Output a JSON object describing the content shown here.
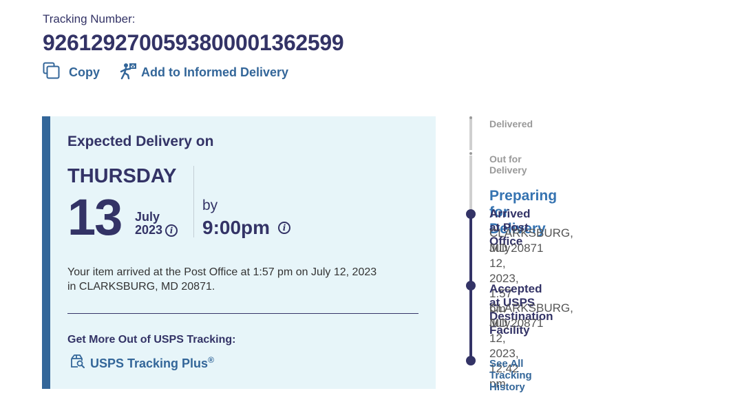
{
  "tracking": {
    "label": "Tracking Number:",
    "number": "9261292700593800001362599",
    "copy_label": "Copy",
    "informed_delivery_label": "Add to Informed Delivery"
  },
  "expected_delivery": {
    "title": "Expected Delivery on",
    "day_of_week": "THURSDAY",
    "date": "13",
    "month": "July",
    "year": "2023",
    "by_label": "by",
    "time": "9:00pm",
    "message_line1": "Your item arrived at the Post Office at 1:57 pm on July 12, 2023",
    "message_line2": "in CLARKSBURG, MD 20871.",
    "get_more_label": "Get More Out of USPS Tracking:",
    "tracking_plus_label": "USPS Tracking Plus",
    "tracking_plus_mark": "®"
  },
  "progress": {
    "steps": [
      "Delivered",
      "Out for Delivery"
    ],
    "current_status": "Preparing for Delivery",
    "events": [
      {
        "event": "Arrived at Post Office",
        "location": "CLARKSBURG, MD 20871",
        "datetime": "July 12, 2023, 1:57 pm"
      },
      {
        "event": "Accepted at USPS Destination Facility",
        "location": "CLARKSBURG, MD 20871",
        "datetime": "July 12, 2023, 12:42 pm"
      }
    ],
    "history_link": "See All Tracking History"
  },
  "colors": {
    "navy": "#333366",
    "link_blue": "#336699",
    "card_bg": "#e7f5f9",
    "current_status_blue": "#3573b1"
  },
  "icons": {
    "copy": "copy-icon",
    "informed_delivery": "mail-carrier-icon",
    "info": "info-icon",
    "tracking_plus": "package-search-icon"
  }
}
